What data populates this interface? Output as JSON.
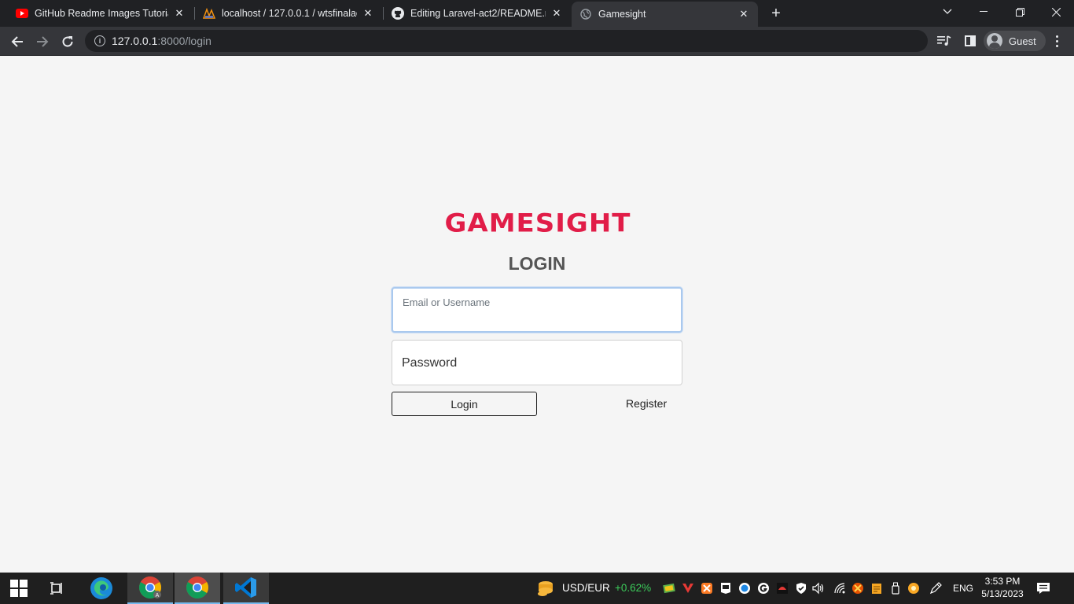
{
  "browser": {
    "tabs": [
      {
        "title": "GitHub Readme Images Tutorial (",
        "icon": "youtube-icon"
      },
      {
        "title": "localhost / 127.0.0.1 / wtsfinalact",
        "icon": "phpmyadmin-icon"
      },
      {
        "title": "Editing Laravel-act2/README.md",
        "icon": "github-icon"
      },
      {
        "title": "Gamesight",
        "icon": "globe-icon",
        "active": true
      }
    ],
    "url_host": "127.0.0.1",
    "url_path": ":8000/login",
    "profile_label": "Guest"
  },
  "page": {
    "logo_text": "GAMESIGHT",
    "title": "LOGIN",
    "email_placeholder": "Email or Username",
    "password_placeholder": "Password",
    "login_button": "Login",
    "register_link": "Register",
    "brand_color": "#e11d48"
  },
  "taskbar": {
    "widget_label": "USD/EUR",
    "widget_change": "+0.62%",
    "widget_change_color": "#3ccb5a",
    "language": "ENG",
    "time": "3:53 PM",
    "date": "5/13/2023"
  }
}
